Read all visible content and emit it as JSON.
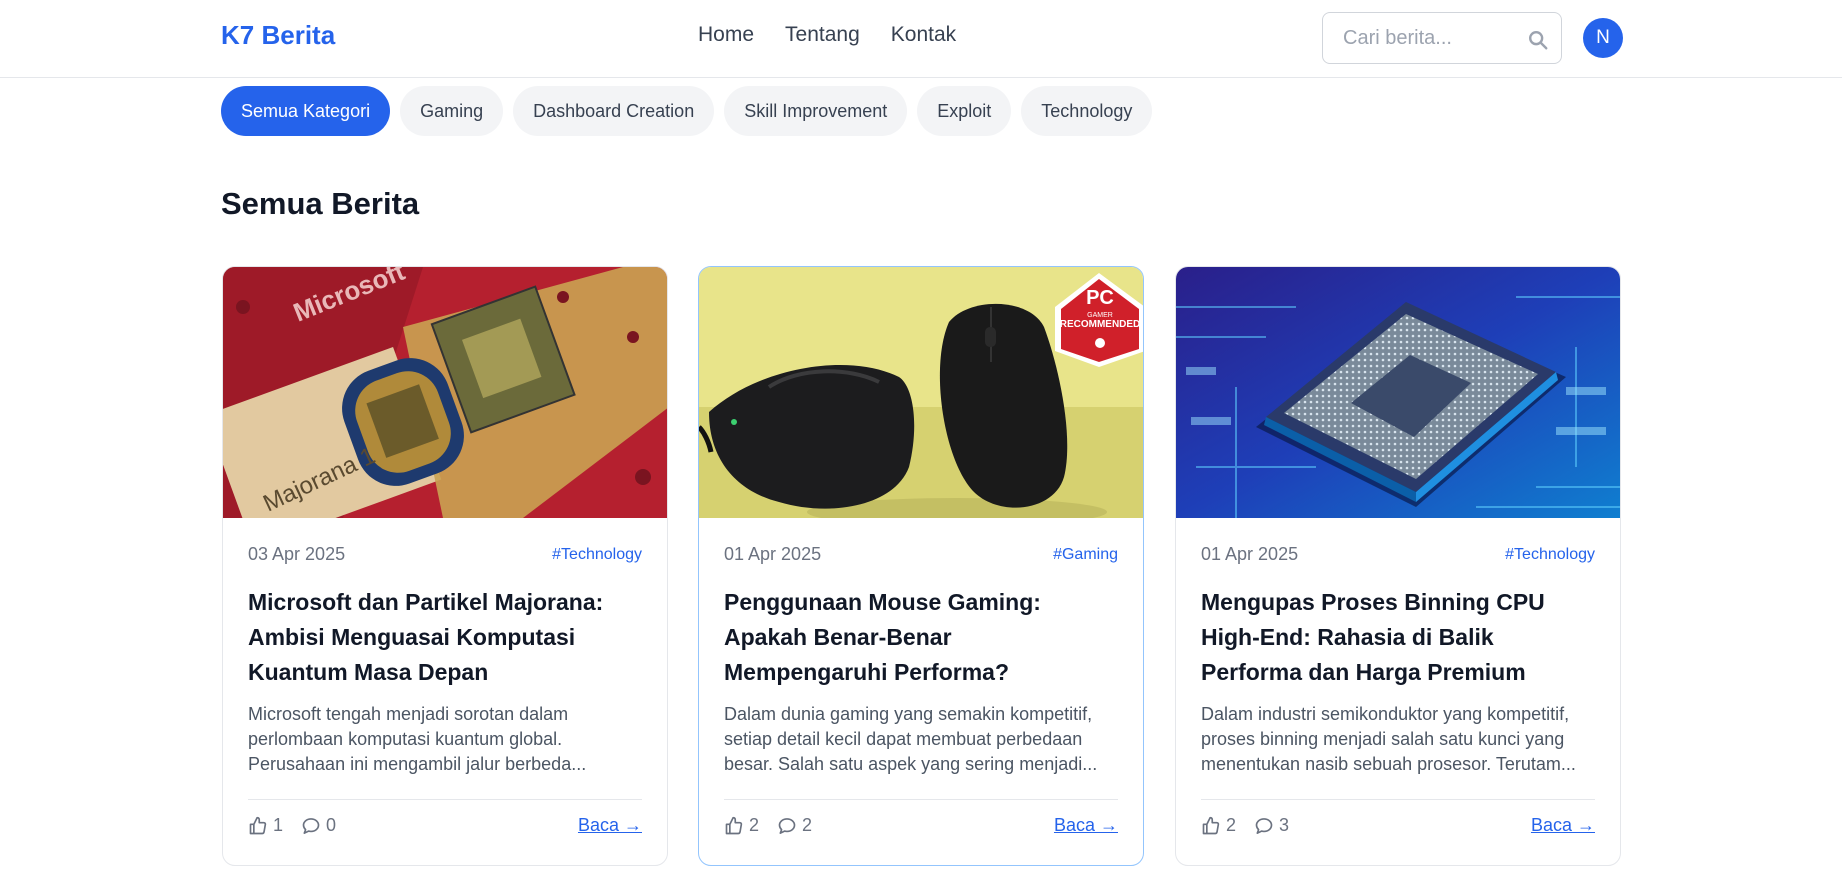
{
  "header": {
    "logo": "K7 Berita",
    "nav": [
      "Home",
      "Tentang",
      "Kontak"
    ],
    "search_placeholder": "Cari berita...",
    "avatar_initial": "N",
    "brand_color": "#2563eb"
  },
  "categories": [
    "Semua Kategori",
    "Gaming",
    "Dashboard Creation",
    "Skill Improvement",
    "Exploit",
    "Technology"
  ],
  "active_category": "Semua Kategori",
  "section_title": "Semua Berita",
  "articles": [
    {
      "date": "03 Apr 2025",
      "tag": "#Technology",
      "title": "Microsoft dan Partikel Majorana: Ambisi Menguasai Komputasi Kuantum Masa Depan",
      "excerpt": "Microsoft tengah menjadi sorotan dalam perlombaan komputasi kuantum global. Perusahaan ini mengambil jalur berbeda...",
      "likes": "1",
      "comments": "0",
      "read_label": "Baca →",
      "image_icon": "quantum-chip-image",
      "image_text": [
        "Microsoft",
        "Majorana 1"
      ]
    },
    {
      "date": "01 Apr 2025",
      "tag": "#Gaming",
      "title": "Penggunaan Mouse Gaming: Apakah Benar-Benar Mempengaruhi Performa?",
      "excerpt": "Dalam dunia gaming yang semakin kompetitif, setiap detail kecil dapat membuat perbedaan besar. Salah satu aspek yang sering menjadi...",
      "likes": "2",
      "comments": "2",
      "read_label": "Baca →",
      "image_icon": "gaming-mouse-image",
      "image_text": [
        "PC",
        "GAMER",
        "RECOMMENDED"
      ]
    },
    {
      "date": "01 Apr 2025",
      "tag": "#Technology",
      "title": "Mengupas Proses Binning CPU High-End: Rahasia di Balik Performa dan Harga Premium",
      "excerpt": "Dalam industri semikonduktor yang kompetitif, proses binning menjadi salah satu kunci yang menentukan nasib sebuah prosesor. Terutam...",
      "likes": "2",
      "comments": "3",
      "read_label": "Baca →",
      "image_icon": "cpu-chip-image"
    }
  ]
}
